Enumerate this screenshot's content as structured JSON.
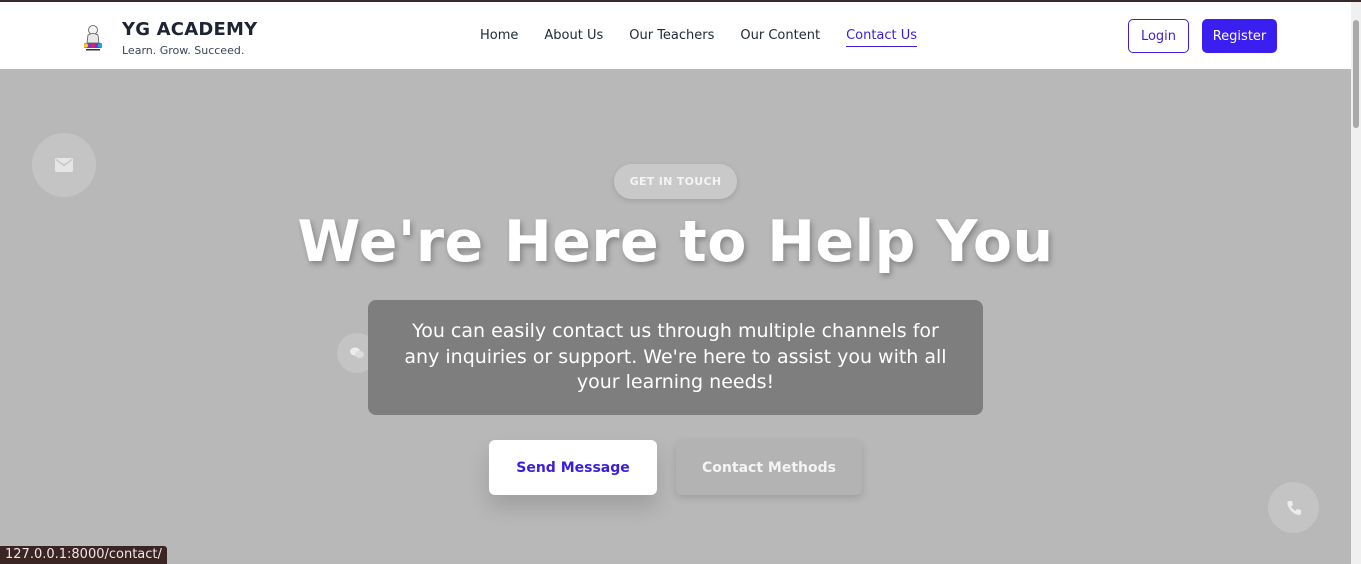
{
  "brand": {
    "name": "YG ACADEMY",
    "tagline": "Learn. Grow. Succeed.",
    "logo_icon": "academy-logo-icon"
  },
  "nav": {
    "items": [
      {
        "label": "Home"
      },
      {
        "label": "About Us"
      },
      {
        "label": "Our Teachers"
      },
      {
        "label": "Our Content"
      },
      {
        "label": "Contact Us",
        "active": true
      }
    ],
    "login_label": "Login",
    "register_label": "Register"
  },
  "hero": {
    "badge": "GET IN TOUCH",
    "title": "We're Here to Help You",
    "description": "You can easily contact us through multiple channels for any inquiries or support. We're here to assist you with all your learning needs!",
    "send_button": "Send Message",
    "methods_button": "Contact Methods"
  },
  "status_url": "127.0.0.1:8000/contact/",
  "colors": {
    "accent": "#3b1ff0",
    "hero_bg": "#b8b8b8",
    "text_dark": "#1e2433"
  }
}
